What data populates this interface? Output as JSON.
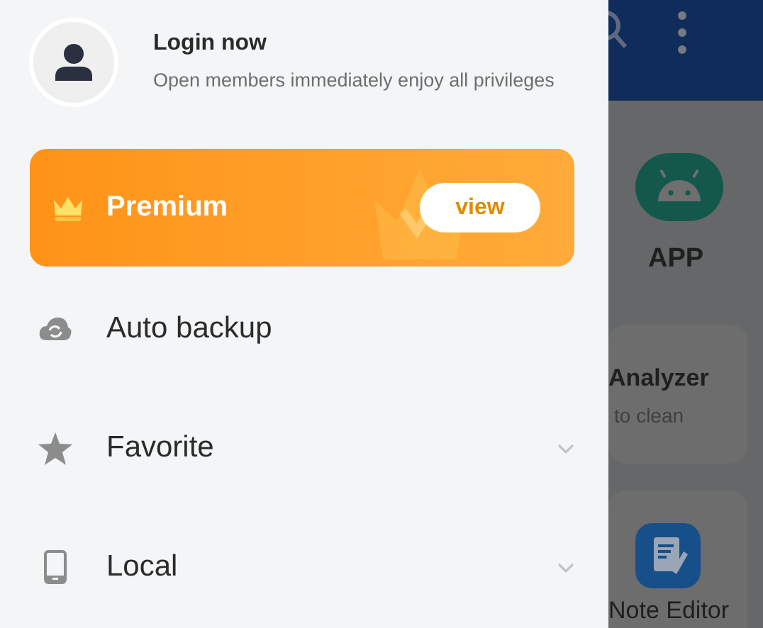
{
  "drawer": {
    "profile": {
      "title": "Login now",
      "subtitle": "Open members immediately enjoy all privileges"
    },
    "premium": {
      "label": "Premium",
      "button": "view"
    },
    "items": [
      {
        "kind": "plain",
        "label": "Auto backup"
      },
      {
        "kind": "expandable",
        "label": "Favorite"
      },
      {
        "kind": "expandable",
        "label": "Local"
      }
    ]
  },
  "background": {
    "app_tile": "APP",
    "cards": [
      {
        "title": "Analyzer",
        "subtitle": "to clean"
      },
      {
        "title": "Note Editor"
      }
    ]
  }
}
